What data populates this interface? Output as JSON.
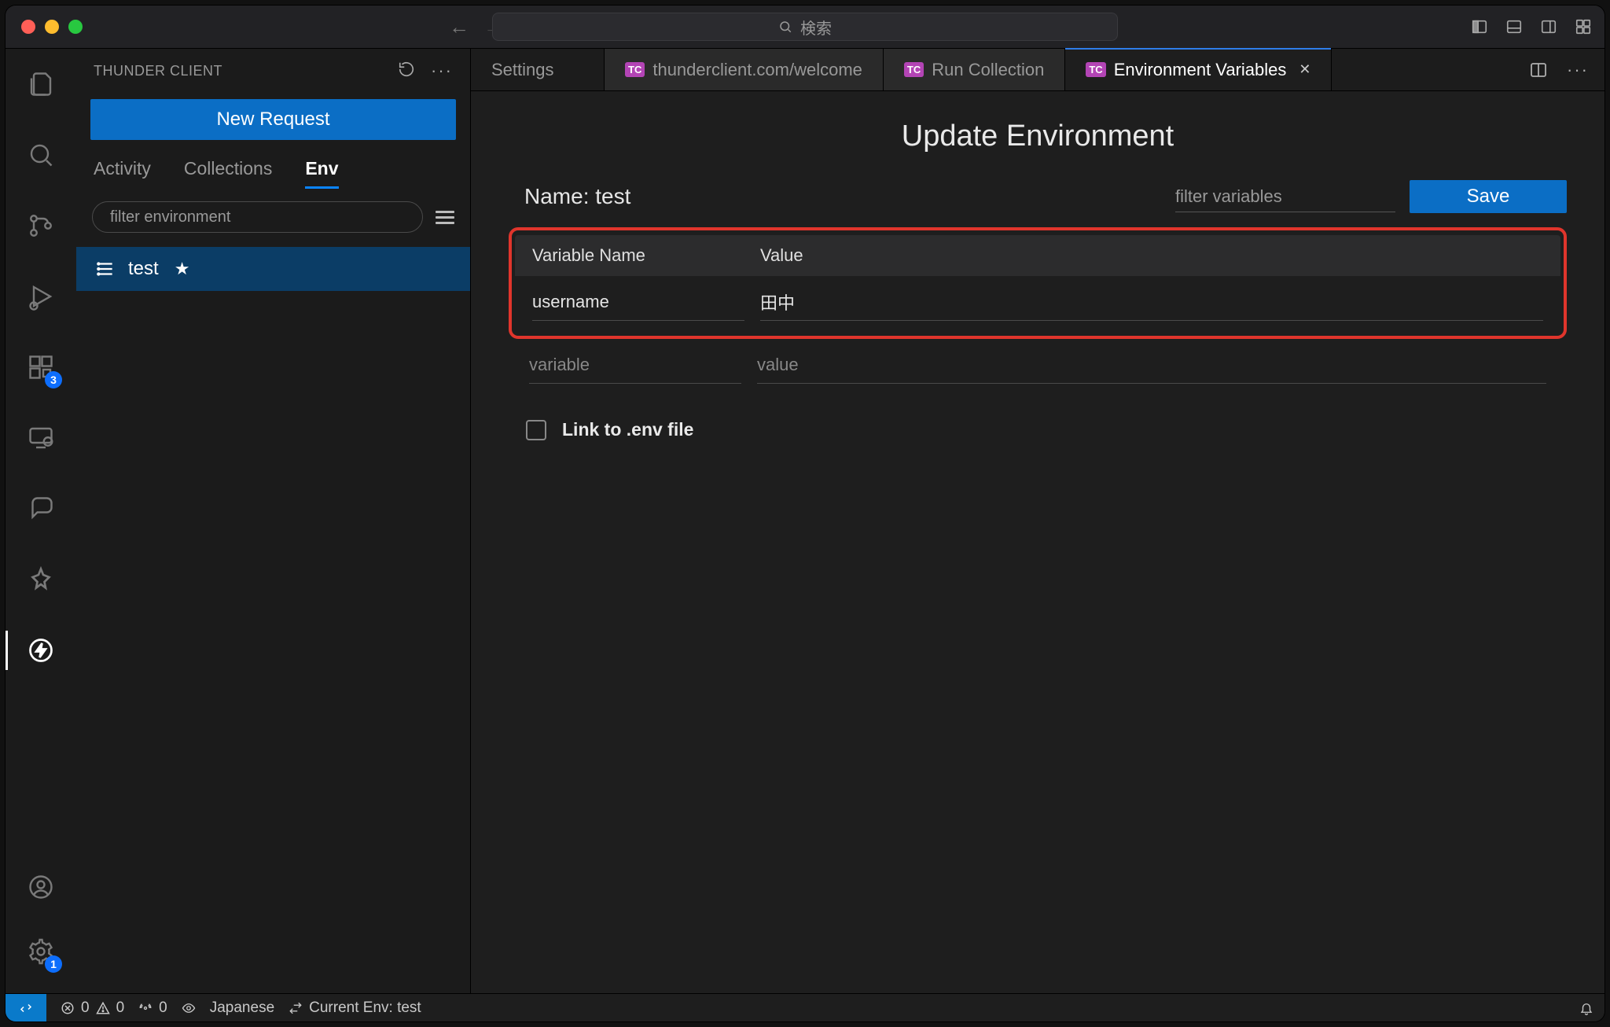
{
  "titlebar": {
    "search_placeholder": "検索"
  },
  "activitybar": {
    "extensions_badge": "3",
    "settings_badge": "1"
  },
  "sidebar": {
    "title": "THUNDER CLIENT",
    "new_request_label": "New Request",
    "tabs": {
      "activity": "Activity",
      "collections": "Collections",
      "env": "Env"
    },
    "filter_placeholder": "filter environment",
    "env_items": [
      {
        "label": "test",
        "starred": true
      }
    ]
  },
  "editor": {
    "tabs": {
      "settings": "Settings",
      "welcome": "thunderclient.com/welcome",
      "run_collection": "Run Collection",
      "env_vars": "Environment Variables"
    },
    "page_title": "Update Environment",
    "name_label": "Name: test",
    "filter_variables_placeholder": "filter variables",
    "save_label": "Save",
    "table": {
      "col_name": "Variable Name",
      "col_value": "Value",
      "rows": [
        {
          "name": "username",
          "value": "田中"
        }
      ],
      "placeholder_name": "variable",
      "placeholder_value": "value"
    },
    "link_env_label": "Link to .env file"
  },
  "statusbar": {
    "errors": "0",
    "warnings": "0",
    "ports": "0",
    "language": "Japanese",
    "current_env": "Current Env: test"
  }
}
